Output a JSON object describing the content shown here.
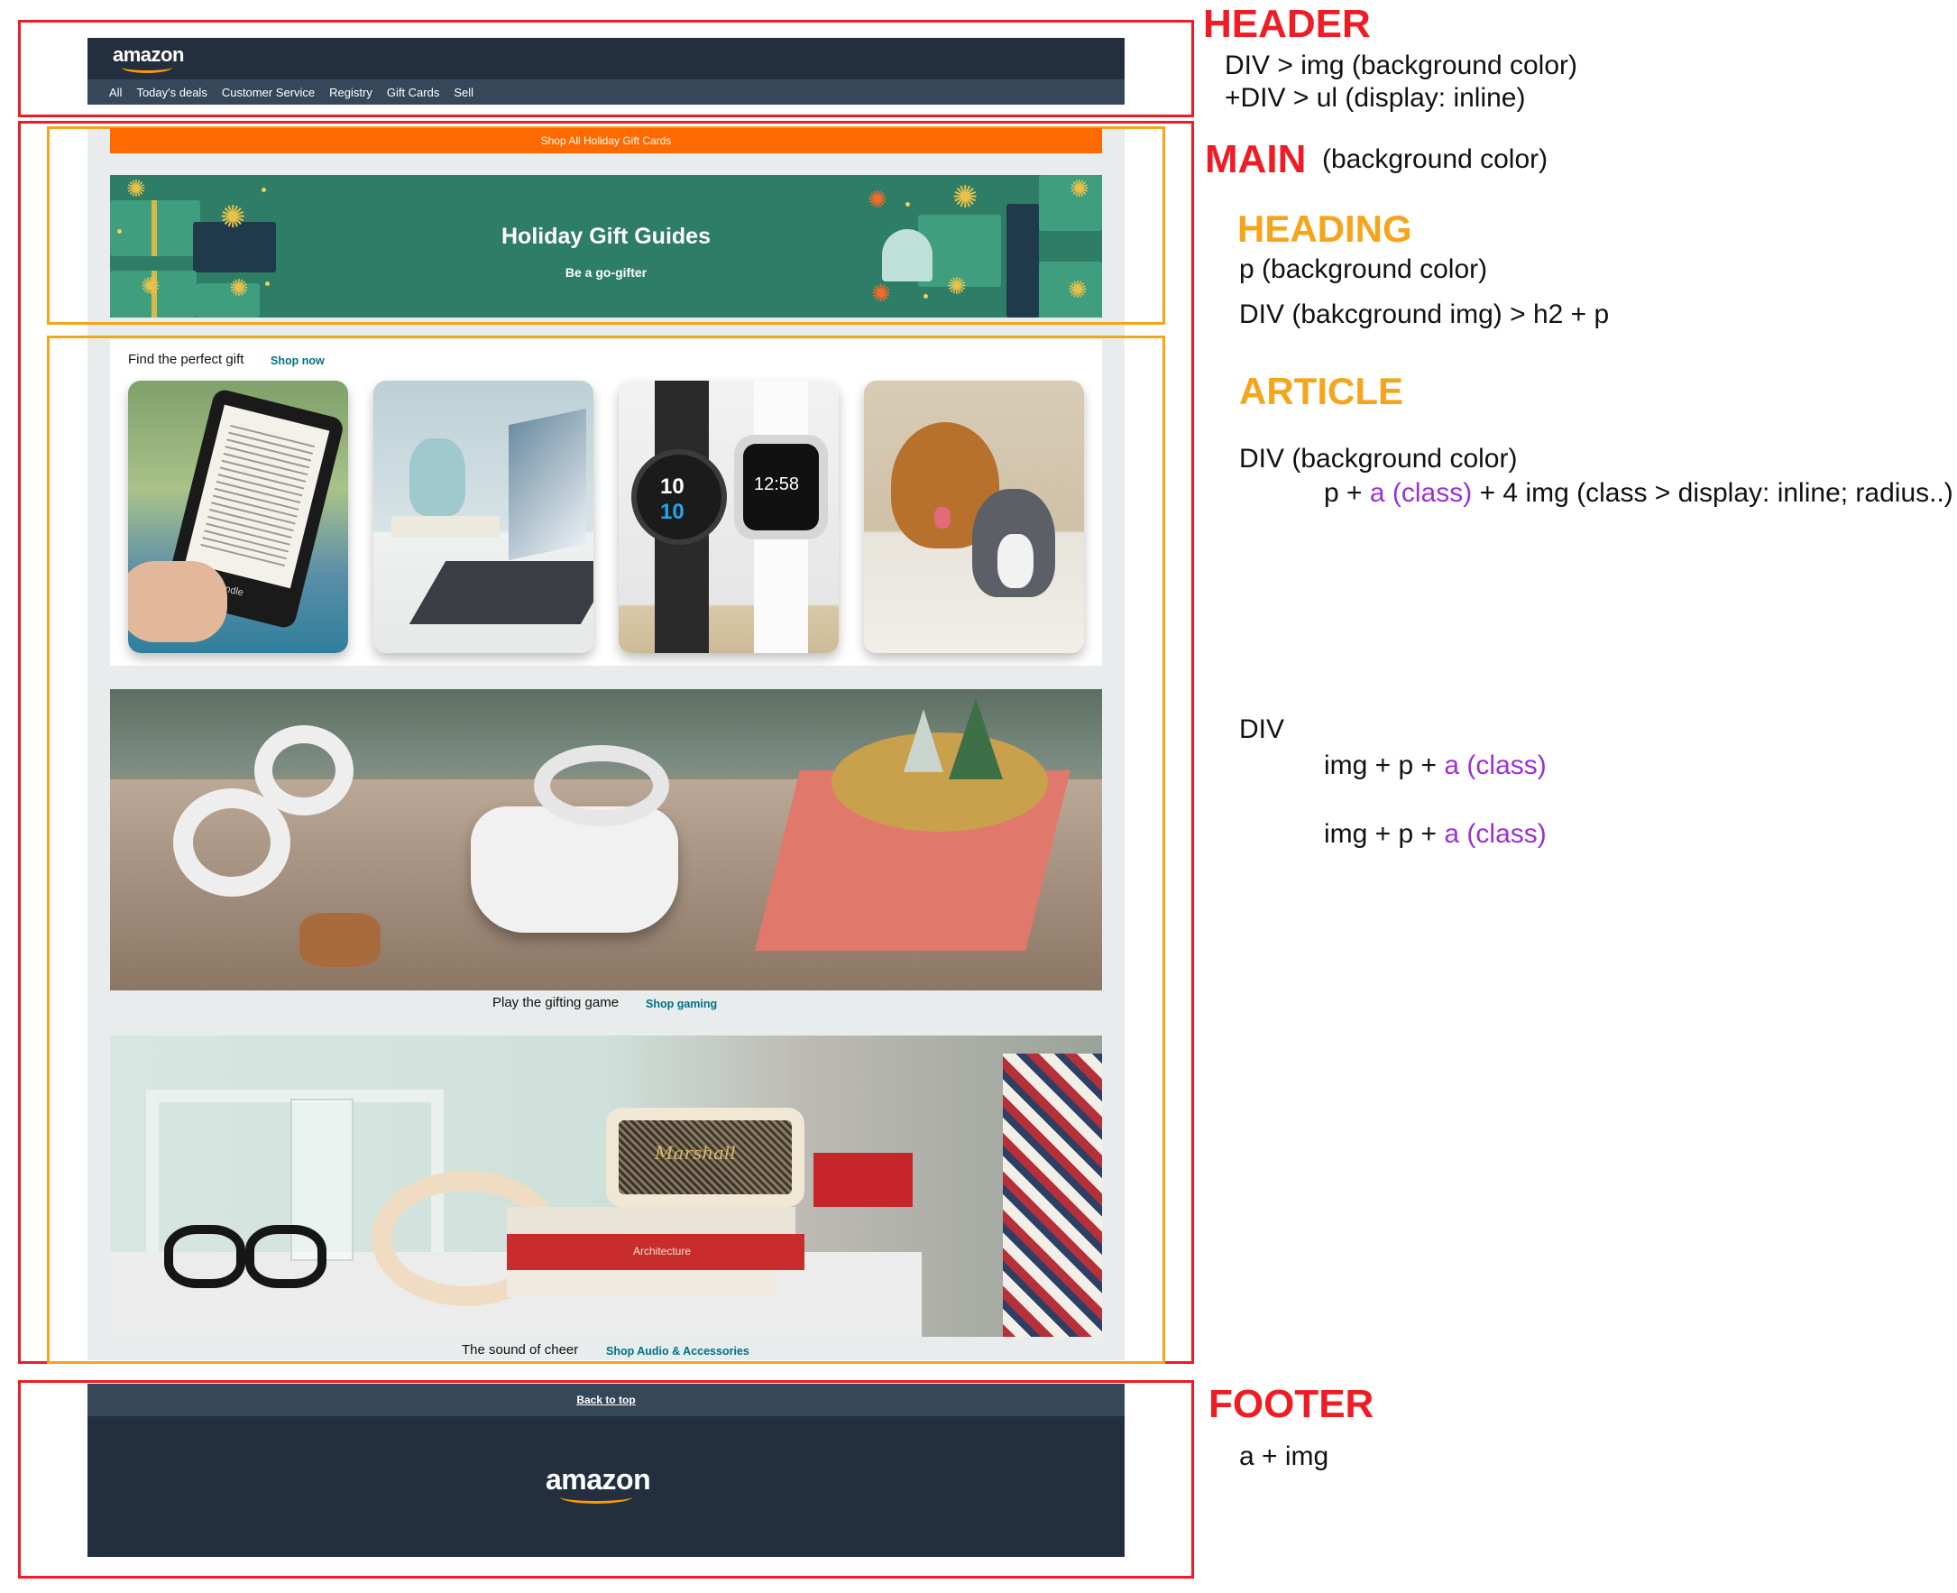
{
  "header": {
    "logo": "amazon",
    "nav": [
      "All",
      "Today's deals",
      "Customer Service",
      "Registry",
      "Gift Cards",
      "Sell"
    ]
  },
  "main": {
    "promo_strip": "Shop All Holiday Gift Cards",
    "hero_title": "Holiday Gift Guides",
    "hero_subtitle": "Be a go-gifter",
    "gift_row": {
      "text": "Find the perfect gift",
      "link": "Shop now",
      "cards": [
        "kindle-ereader",
        "laptop-on-desk",
        "smartwatches",
        "dog-and-cat"
      ]
    },
    "gaming": {
      "text": "Play the gifting game",
      "link": "Shop gaming"
    },
    "audio": {
      "text": "The sound of cheer",
      "link": "Shop Audio & Accessories"
    },
    "watch_text_a": "10",
    "watch_text_b": "10",
    "watch_text_c": "12:58",
    "kindle_brand": "kindle",
    "speaker_brand": "Marshall",
    "book_text": "Architecture"
  },
  "footer": {
    "back_to_top": "Back to top",
    "logo": "amazon"
  },
  "annotations": {
    "header_label": "HEADER",
    "header_line1": "DIV > img (background color)",
    "header_line2": "+DIV > ul (display: inline)",
    "main_label": "MAIN",
    "main_note": "(background color)",
    "heading_label": "HEADING",
    "heading_line1": "p (background color)",
    "heading_line2": "DIV (bakcground img) > h2 + p",
    "article_label": "ARTICLE",
    "article_line1": "DIV (background color)",
    "article_line2_a": "p + ",
    "article_line2_b": "a (class)",
    "article_line2_c": " + 4 img (class > display: inline; radius..)",
    "div_label": "DIV",
    "div_line_a1": "img + p + ",
    "div_line_a2": "a (class)",
    "div_line_b1": "img + p + ",
    "div_line_b2": "a (class)",
    "footer_label": "FOOTER",
    "footer_line": "a + img"
  },
  "colors": {
    "annotation_red": "#ef1c25",
    "annotation_orange": "#f5a51b",
    "annotation_purple": "#9b30d9",
    "amazon_navy": "#232f3e",
    "amazon_nav": "#37475a",
    "amazon_orange": "#ff9900",
    "promo_orange": "#ff6a00",
    "hero_green": "#2e7d67",
    "link_teal": "#007185"
  }
}
